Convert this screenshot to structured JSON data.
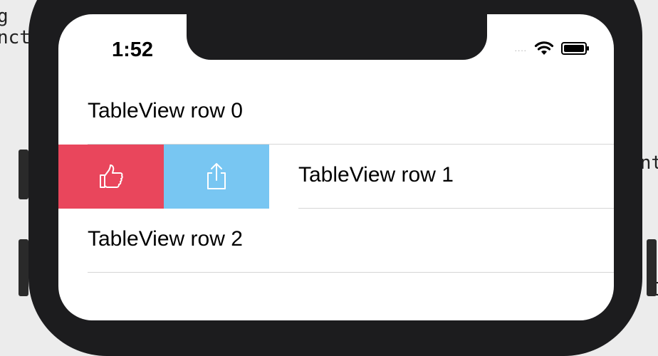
{
  "background": {
    "left_code": [
      "g",
      "nct"
    ],
    "right_code_1": "nt",
    "right_code_2": "I"
  },
  "status_bar": {
    "time": "1:52",
    "signal": "....",
    "icons": [
      "wifi-icon",
      "battery-icon"
    ]
  },
  "table": {
    "rows": [
      {
        "label": "TableView row 0"
      },
      {
        "label": "TableView row 1"
      },
      {
        "label": "TableView row 2"
      }
    ],
    "swipe_actions": [
      {
        "name": "like",
        "icon": "thumbs-up-icon",
        "color": "#e9465c"
      },
      {
        "name": "share",
        "icon": "share-icon",
        "color": "#78c6f2"
      }
    ]
  }
}
